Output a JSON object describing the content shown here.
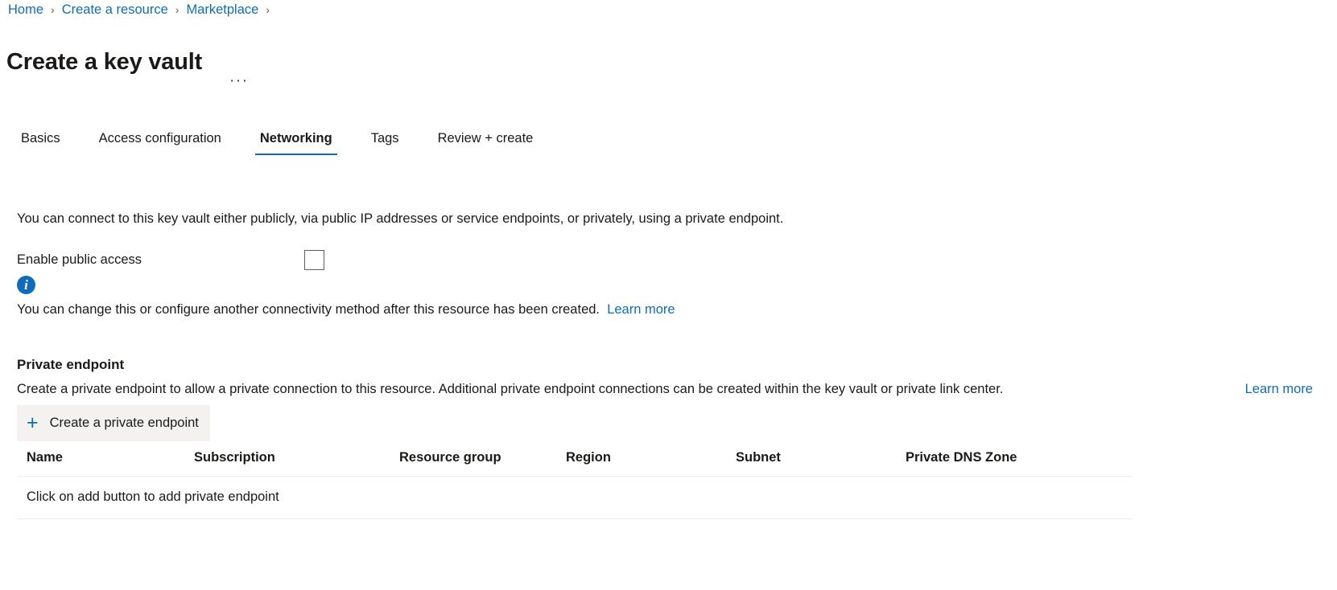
{
  "breadcrumb": {
    "items": [
      {
        "label": "Home"
      },
      {
        "label": "Create a resource"
      },
      {
        "label": "Marketplace"
      }
    ],
    "separator": "›"
  },
  "header": {
    "title": "Create a key vault",
    "more_actions_label": "···"
  },
  "tabs": [
    {
      "label": "Basics",
      "active": false
    },
    {
      "label": "Access configuration",
      "active": false
    },
    {
      "label": "Networking",
      "active": true
    },
    {
      "label": "Tags",
      "active": false
    },
    {
      "label": "Review + create",
      "active": false
    }
  ],
  "main": {
    "intro": "You can connect to this key vault either publicly, via public IP addresses or service endpoints, or privately, using a private endpoint.",
    "public_access": {
      "label": "Enable public access",
      "checked": false
    },
    "info": {
      "icon": "info-circle-icon",
      "text": "You can change this or configure another connectivity method after this resource has been created.",
      "link_label": "Learn more"
    },
    "private_endpoint": {
      "heading": "Private endpoint",
      "description": "Create a private endpoint to allow a private connection to this resource. Additional private endpoint connections can be created within the key vault or private link center.",
      "link_label": "Learn more",
      "create_button": {
        "icon": "plus-icon",
        "label": "Create a private endpoint"
      },
      "table": {
        "columns": [
          "Name",
          "Subscription",
          "Resource group",
          "Region",
          "Subnet",
          "Private DNS Zone"
        ],
        "rows": [],
        "empty_message": "Click on add button to add private endpoint"
      }
    }
  },
  "colors": {
    "link": "#0f6cbd",
    "accent": "#0f6cbd",
    "text": "#1b1a19",
    "button_background": "#f3f2f1",
    "divider": "#edebe9"
  }
}
